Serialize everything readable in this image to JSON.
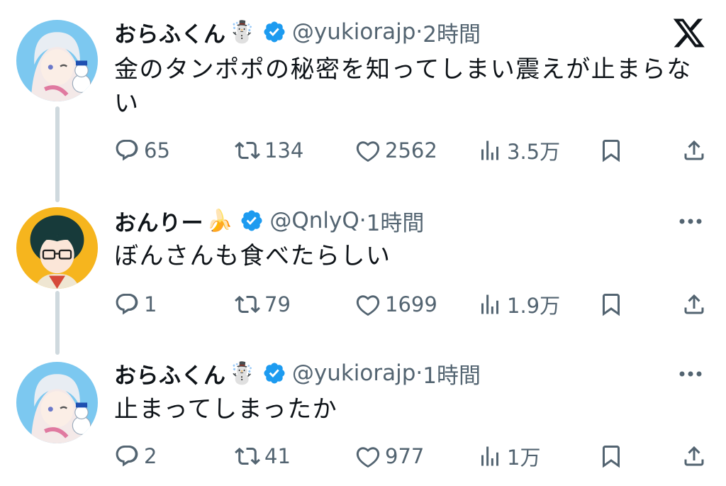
{
  "tweets": [
    {
      "name": "おらふくん",
      "emoji": "☃️",
      "handle": "@yukiorajp",
      "time": "2時間",
      "text_line1": "金のタンポポの秘密を知ってしまい震えが止まらな",
      "text_line2": "い",
      "replies": "65",
      "retweets": "134",
      "likes": "2562",
      "views": "3.5万"
    },
    {
      "name": "おんりー",
      "emoji": "🍌",
      "handle": "@QnlyQ",
      "time": "1時間",
      "text_line1": "ぼんさんも食べたらしい",
      "replies": "1",
      "retweets": "79",
      "likes": "1699",
      "views": "1.9万"
    },
    {
      "name": "おらふくん",
      "emoji": "☃️",
      "handle": "@yukiorajp",
      "time": "1時間",
      "text_line1": "止まってしまったか",
      "replies": "2",
      "retweets": "41",
      "likes": "977",
      "views": "1万"
    }
  ],
  "handle_time_sep": " · ",
  "colors": {
    "verified": "#1d9bf0",
    "muted": "#536471",
    "thread_line": "#cfd9de"
  },
  "icons": [
    "x-logo-icon",
    "verified-badge-icon",
    "reply-icon",
    "retweet-icon",
    "like-icon",
    "views-icon",
    "bookmark-icon",
    "share-icon",
    "more-icon"
  ]
}
